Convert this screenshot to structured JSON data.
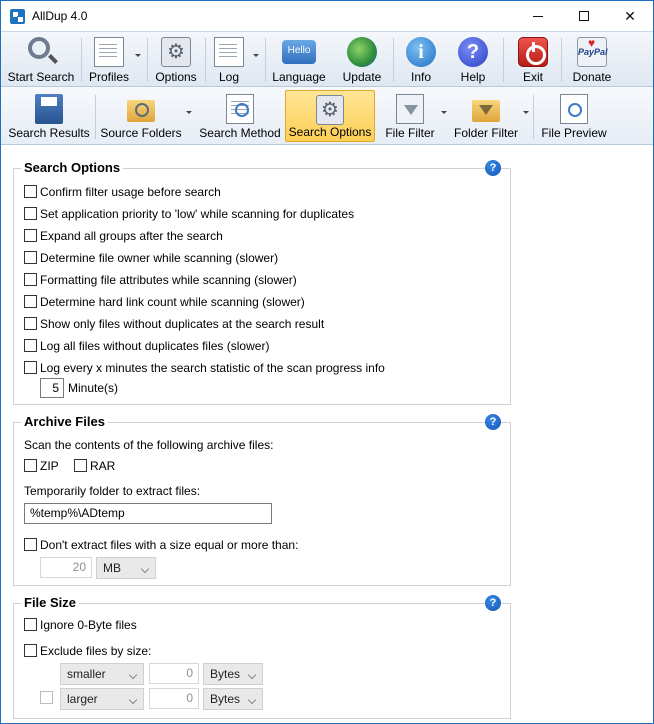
{
  "window": {
    "title": "AllDup 4.0"
  },
  "toolbar_main": [
    {
      "label": "Start Search",
      "icon": "magnifier-icon"
    },
    {
      "label": "Profiles",
      "icon": "profiles-icon"
    },
    {
      "label": "Options",
      "icon": "gear-icon"
    },
    {
      "label": "Log",
      "icon": "log-icon"
    },
    {
      "label": "Language",
      "icon": "language-icon",
      "icon_text": "Hello"
    },
    {
      "label": "Update",
      "icon": "globe-icon"
    },
    {
      "label": "Info",
      "icon": "info-icon",
      "icon_text": "i"
    },
    {
      "label": "Help",
      "icon": "help-icon",
      "icon_text": "?"
    },
    {
      "label": "Exit",
      "icon": "exit-icon"
    },
    {
      "label": "Donate",
      "icon": "paypal-icon",
      "icon_text": "PayPal"
    }
  ],
  "toolbar_sections": [
    {
      "label": "Search Results",
      "icon": "disk-icon"
    },
    {
      "label": "Source Folders",
      "icon": "folder-icon"
    },
    {
      "label": "Search Method",
      "icon": "search-method-icon"
    },
    {
      "label": "Search Options",
      "icon": "search-options-icon",
      "active": true
    },
    {
      "label": "File Filter",
      "icon": "filter-icon"
    },
    {
      "label": "Folder Filter",
      "icon": "folder-filter-icon"
    },
    {
      "label": "File Preview",
      "icon": "preview-icon"
    }
  ],
  "search_options": {
    "title": "Search Options",
    "help": "?",
    "items": [
      "Confirm filter usage before search",
      "Set application priority to 'low' while scanning for duplicates",
      "Expand all groups after the search",
      "Determine file owner while scanning (slower)",
      "Formatting file attributes while scanning (slower)",
      "Determine hard link count while scanning (slower)",
      "Show only files without duplicates at the search result",
      "Log all files without duplicates files (slower)",
      "Log every x minutes the search statistic of the scan progress info"
    ],
    "minutes_value": "5",
    "minutes_label": "Minute(s)"
  },
  "archive_files": {
    "title": "Archive Files",
    "help": "?",
    "scan_label": "Scan the contents of the following archive files:",
    "zip_label": "ZIP",
    "rar_label": "RAR",
    "temp_label": "Temporarily folder to extract files:",
    "temp_value": "%temp%\\ADtemp",
    "size_limit_label": "Don't extract files with a size equal or more than:",
    "size_limit_value": "20",
    "size_limit_unit": "MB"
  },
  "file_size": {
    "title": "File Size",
    "help": "?",
    "ignore_zero_label": "Ignore 0-Byte files",
    "exclude_label": "Exclude files by size:",
    "smaller_op": "smaller",
    "smaller_value": "0",
    "smaller_unit": "Bytes",
    "larger_op": "larger",
    "larger_value": "0",
    "larger_unit": "Bytes"
  }
}
